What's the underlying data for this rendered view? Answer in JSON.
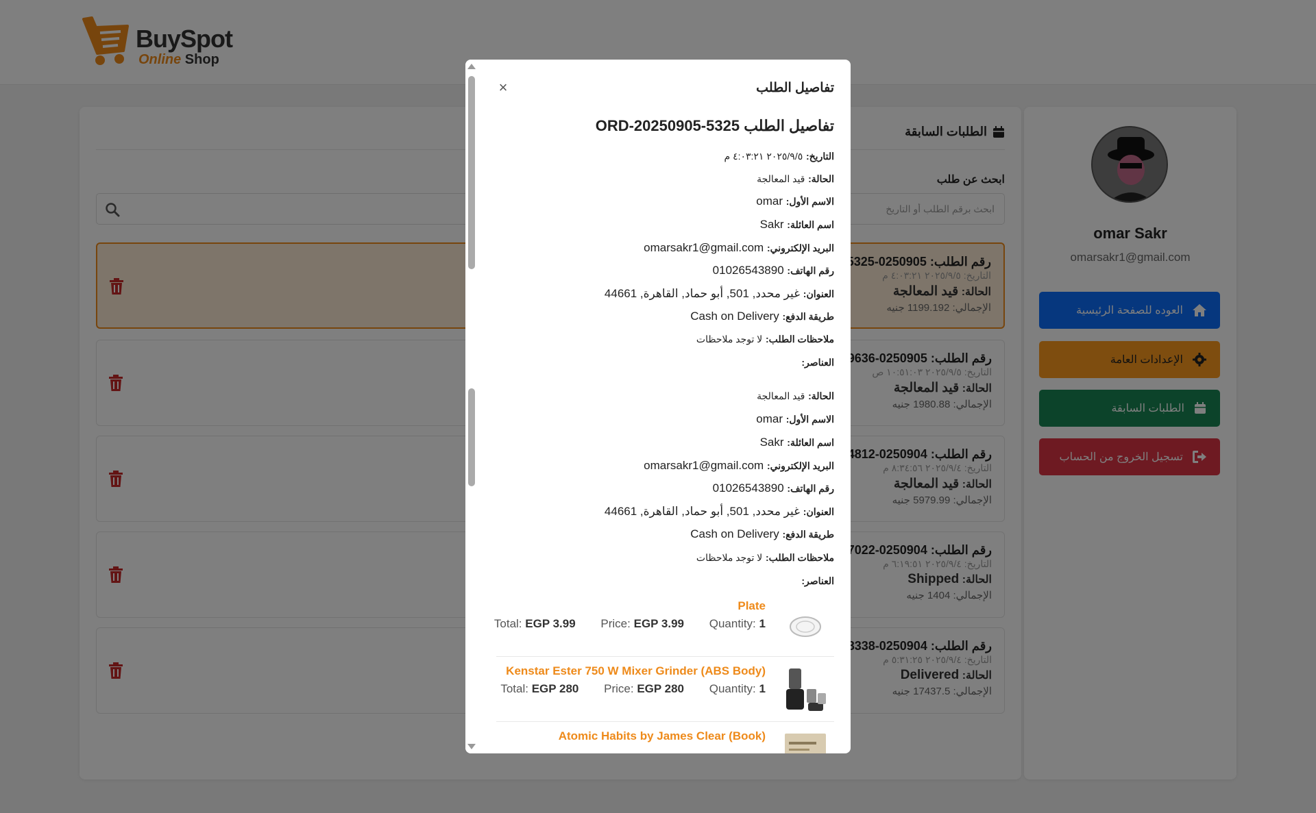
{
  "brand": {
    "name": "BuySpot",
    "tag_orange": "Online",
    "tag_rest": "Shop"
  },
  "orders": {
    "title": "الطلبات السابقة",
    "search_label": "ابحث عن طلب",
    "search_placeholder": "ابحث برقم الطلب أو التاريخ",
    "list": [
      {
        "num_label": "رقم الطلب:",
        "num": "0250905-5325",
        "date": "التاريخ: ٢٠٢٥/٩/٥ ٤:٠٣:٢١ م",
        "status_label": "الحالة:",
        "status": "قيد المعالجة",
        "total": "الإجمالي: 1199.192 جنيه"
      },
      {
        "num_label": "رقم الطلب:",
        "num": "0250905-9636",
        "date": "التاريخ: ٢٠٢٥/٩/٥ ١٠:٥١:٠٣ ص",
        "status_label": "الحالة:",
        "status": "قيد المعالجة",
        "total": "الإجمالي: 1980.88 جنيه"
      },
      {
        "num_label": "رقم الطلب:",
        "num": "0250904-4812",
        "date": "التاريخ: ٢٠٢٥/٩/٤ ٨:٣٤:٥٦ م",
        "status_label": "الحالة:",
        "status": "قيد المعالجة",
        "total": "الإجمالي: 5979.99 جنيه"
      },
      {
        "num_label": "رقم الطلب:",
        "num": "0250904-7022",
        "date": "التاريخ: ٢٠٢٥/٩/٤ ٦:١٩:٥١ م",
        "status_label": "الحالة:",
        "status": "Shipped",
        "total": "الإجمالي: 1404 جنيه"
      },
      {
        "num_label": "رقم الطلب:",
        "num": "0250904-8338",
        "date": "التاريخ: ٢٠٢٥/٩/٤ ٥:٣١:٢٥ م",
        "status_label": "الحالة:",
        "status": "Delivered",
        "total": "الإجمالي: 17437.5 جنيه"
      }
    ]
  },
  "profile": {
    "name": "omar Sakr",
    "email": "omarsakr1@gmail.com",
    "buttons": {
      "home": "العوده للصفحة الرئيسية",
      "settings": "الإعدادات العامة",
      "orders": "الطلبات السابقة",
      "logout": "تسجيل الخروج من الحساب"
    }
  },
  "modal": {
    "title": "تفاصيل الطلب",
    "close": "×",
    "heading": "تفاصيل الطلب ORD-20250905-5325",
    "date_label": "التاريخ:",
    "date": "٢٠٢٥/٩/٥ ٤:٠٣:٢١ م",
    "status_label": "الحالة:",
    "status": "قيد المعالجة",
    "first_name_label": "الاسم الأول:",
    "first_name": "omar",
    "last_name_label": "اسم العائلة:",
    "last_name": "Sakr",
    "email_label": "البريد الإلكتروني:",
    "email": "omarsakr1@gmail.com",
    "phone_label": "رقم الهاتف:",
    "phone": "01026543890",
    "address_label": "العنوان:",
    "address": "غير محدد, 501, أبو حماد, القاهرة, 44661",
    "payment_label": "طريقة الدفع:",
    "payment": "Cash on Delivery",
    "notes_label": "ملاحظات الطلب:",
    "notes": "لا توجد ملاحظات",
    "items_label": "العناصر:",
    "items": [
      {
        "name": "Plate",
        "total_label": "Total:",
        "total": "EGP 3.99",
        "price_label": "Price:",
        "price": "EGP 3.99",
        "qty_label": "Quantity:",
        "qty": "1"
      },
      {
        "name": "Kenstar Ester 750 W Mixer Grinder (ABS Body)",
        "total_label": "Total:",
        "total": "EGP 280",
        "price_label": "Price:",
        "price": "EGP 280",
        "qty_label": "Quantity:",
        "qty": "1"
      },
      {
        "name": "Atomic Habits by James Clear (Book)",
        "total_label": "",
        "total": "",
        "price_label": "",
        "price": "",
        "qty_label": "",
        "qty": ""
      }
    ]
  },
  "colors": {
    "accent": "#ee8a1a",
    "blue": "#0d6efd",
    "orange": "#fd9a1f",
    "green": "#198754",
    "red": "#dc3545",
    "trash": "#c62828"
  }
}
